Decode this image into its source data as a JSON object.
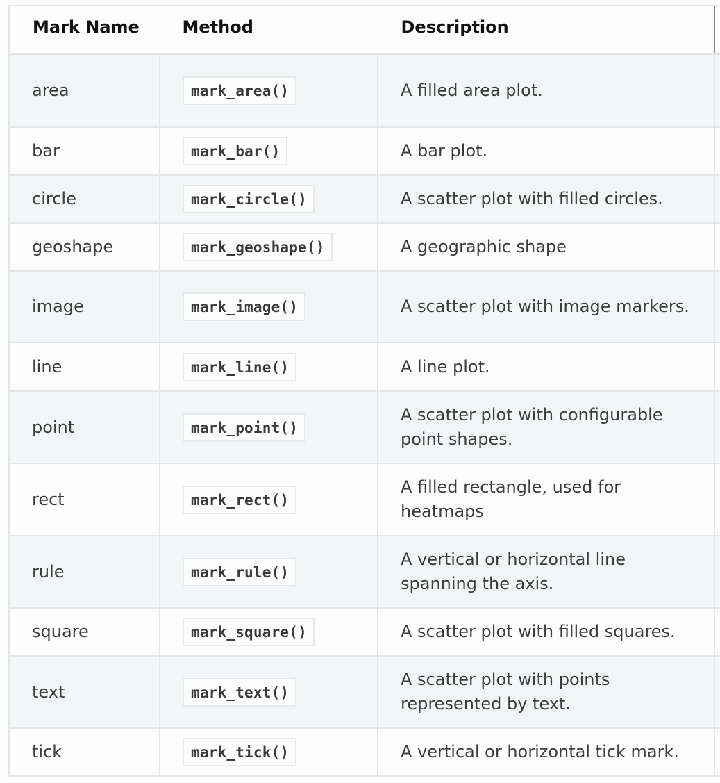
{
  "table": {
    "headers": [
      "Mark Name",
      "Method",
      "Description"
    ],
    "rows": [
      {
        "name": "area",
        "method": "mark_area()",
        "description": "A filled area plot."
      },
      {
        "name": "bar",
        "method": "mark_bar()",
        "description": "A bar plot."
      },
      {
        "name": "circle",
        "method": "mark_circle()",
        "description": "A scatter plot with filled circles."
      },
      {
        "name": "geoshape",
        "method": "mark_geoshape()",
        "description": "A geographic shape"
      },
      {
        "name": "image",
        "method": "mark_image()",
        "description": "A scatter plot with image markers."
      },
      {
        "name": "line",
        "method": "mark_line()",
        "description": "A line plot."
      },
      {
        "name": "point",
        "method": "mark_point()",
        "description": "A scatter plot with configurable point shapes."
      },
      {
        "name": "rect",
        "method": "mark_rect()",
        "description": "A filled rectangle, used for heatmaps"
      },
      {
        "name": "rule",
        "method": "mark_rule()",
        "description": "A vertical or horizontal line spanning the axis."
      },
      {
        "name": "square",
        "method": "mark_square()",
        "description": "A scatter plot with filled squares."
      },
      {
        "name": "text",
        "method": "mark_text()",
        "description": "A scatter plot with points represented by text."
      },
      {
        "name": "tick",
        "method": "mark_tick()",
        "description": "A vertical or horizontal tick mark."
      }
    ]
  }
}
